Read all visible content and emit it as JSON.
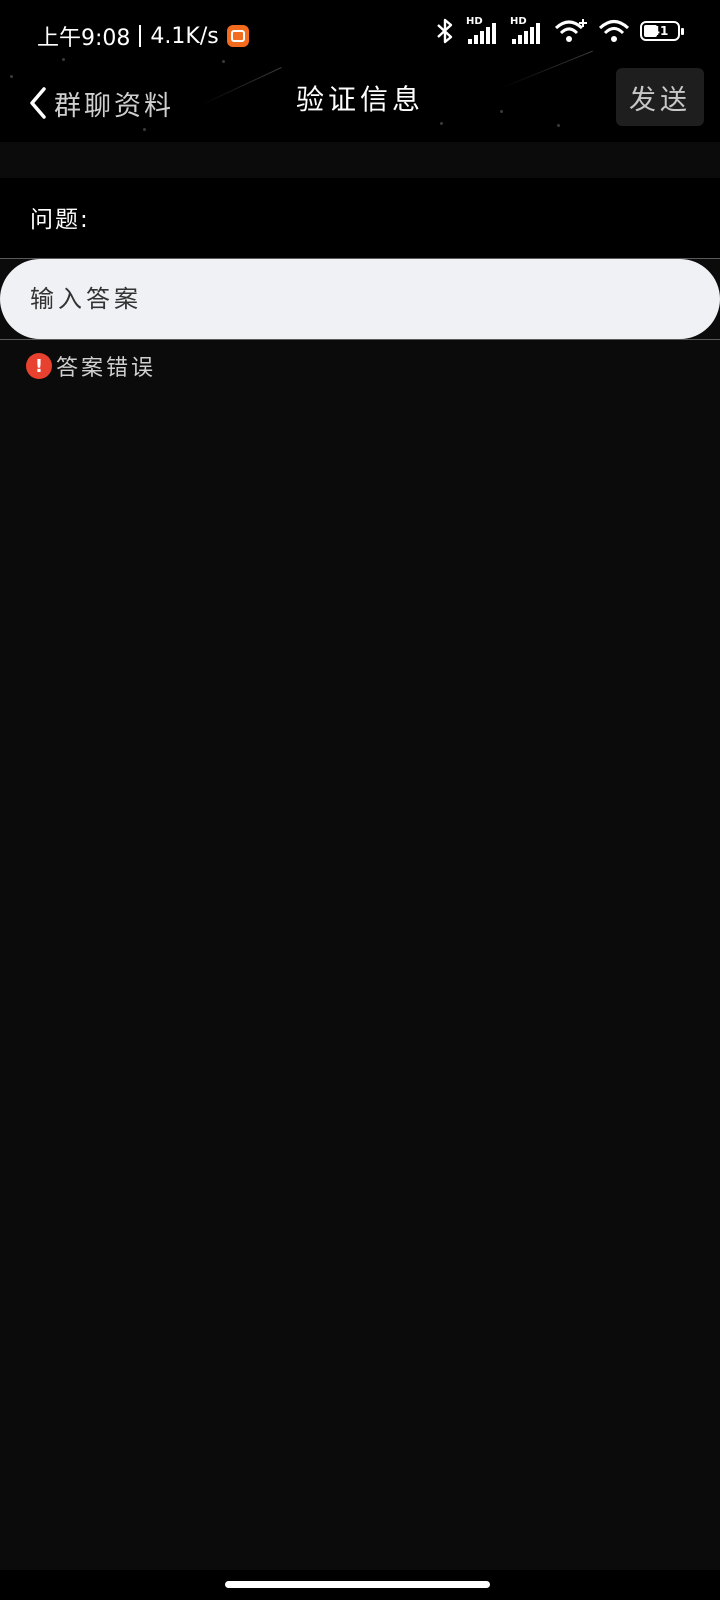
{
  "status_bar": {
    "time": "上午9:08",
    "net_speed": "4.1K/s",
    "battery_level": "41",
    "battery_fraction": 0.41,
    "icons": [
      "app-badge-icon",
      "bluetooth-icon",
      "hd-signal-icon",
      "hd-signal-icon",
      "wifi-plus-icon",
      "wifi-icon",
      "battery-icon"
    ]
  },
  "nav": {
    "back_label": "群聊资料",
    "title": "验证信息",
    "send_label": "发送"
  },
  "form": {
    "question_label": "问题:",
    "answer_placeholder": "输入答案",
    "answer_value": "",
    "error_text": "答案错误"
  },
  "colors": {
    "background": "#0b0b0b",
    "input_bg": "#f0f1f5",
    "error_red": "#e8412f",
    "app_badge": "#f36b1c"
  }
}
